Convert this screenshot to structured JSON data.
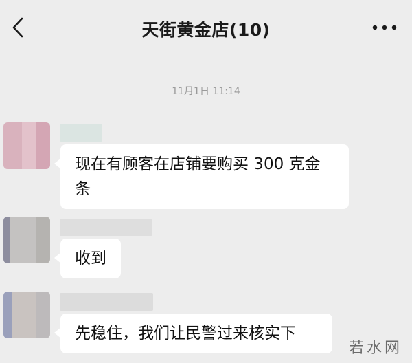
{
  "header": {
    "back_icon": "chevron-left-icon",
    "title": "天街黄金店(10)",
    "more_icon": "more-dots-icon"
  },
  "chat": {
    "timestamp": "11月1日 11:14",
    "messages": [
      {
        "text": "现在有顾客在店铺要购买300克金条",
        "line1": "现在有顾客在店铺要购买 300 克金",
        "line2": "条",
        "avatar_colors": [
          "#d9b2bd",
          "#e3c2cb",
          "#d4a6b4"
        ],
        "name_color": "#dbe5e2"
      },
      {
        "text": "收到",
        "avatar_colors": [
          "#8d8d9e",
          "#c4c2c1",
          "#b5b3b0"
        ],
        "name_color": "#dedede"
      },
      {
        "text": "先稳住，我们让民警过来核实下",
        "avatar_colors": [
          "#9aa0bb",
          "#c9c3c0",
          "#bdbabb"
        ],
        "name_color": "#dcdcdc"
      }
    ]
  },
  "watermark": "若水网"
}
